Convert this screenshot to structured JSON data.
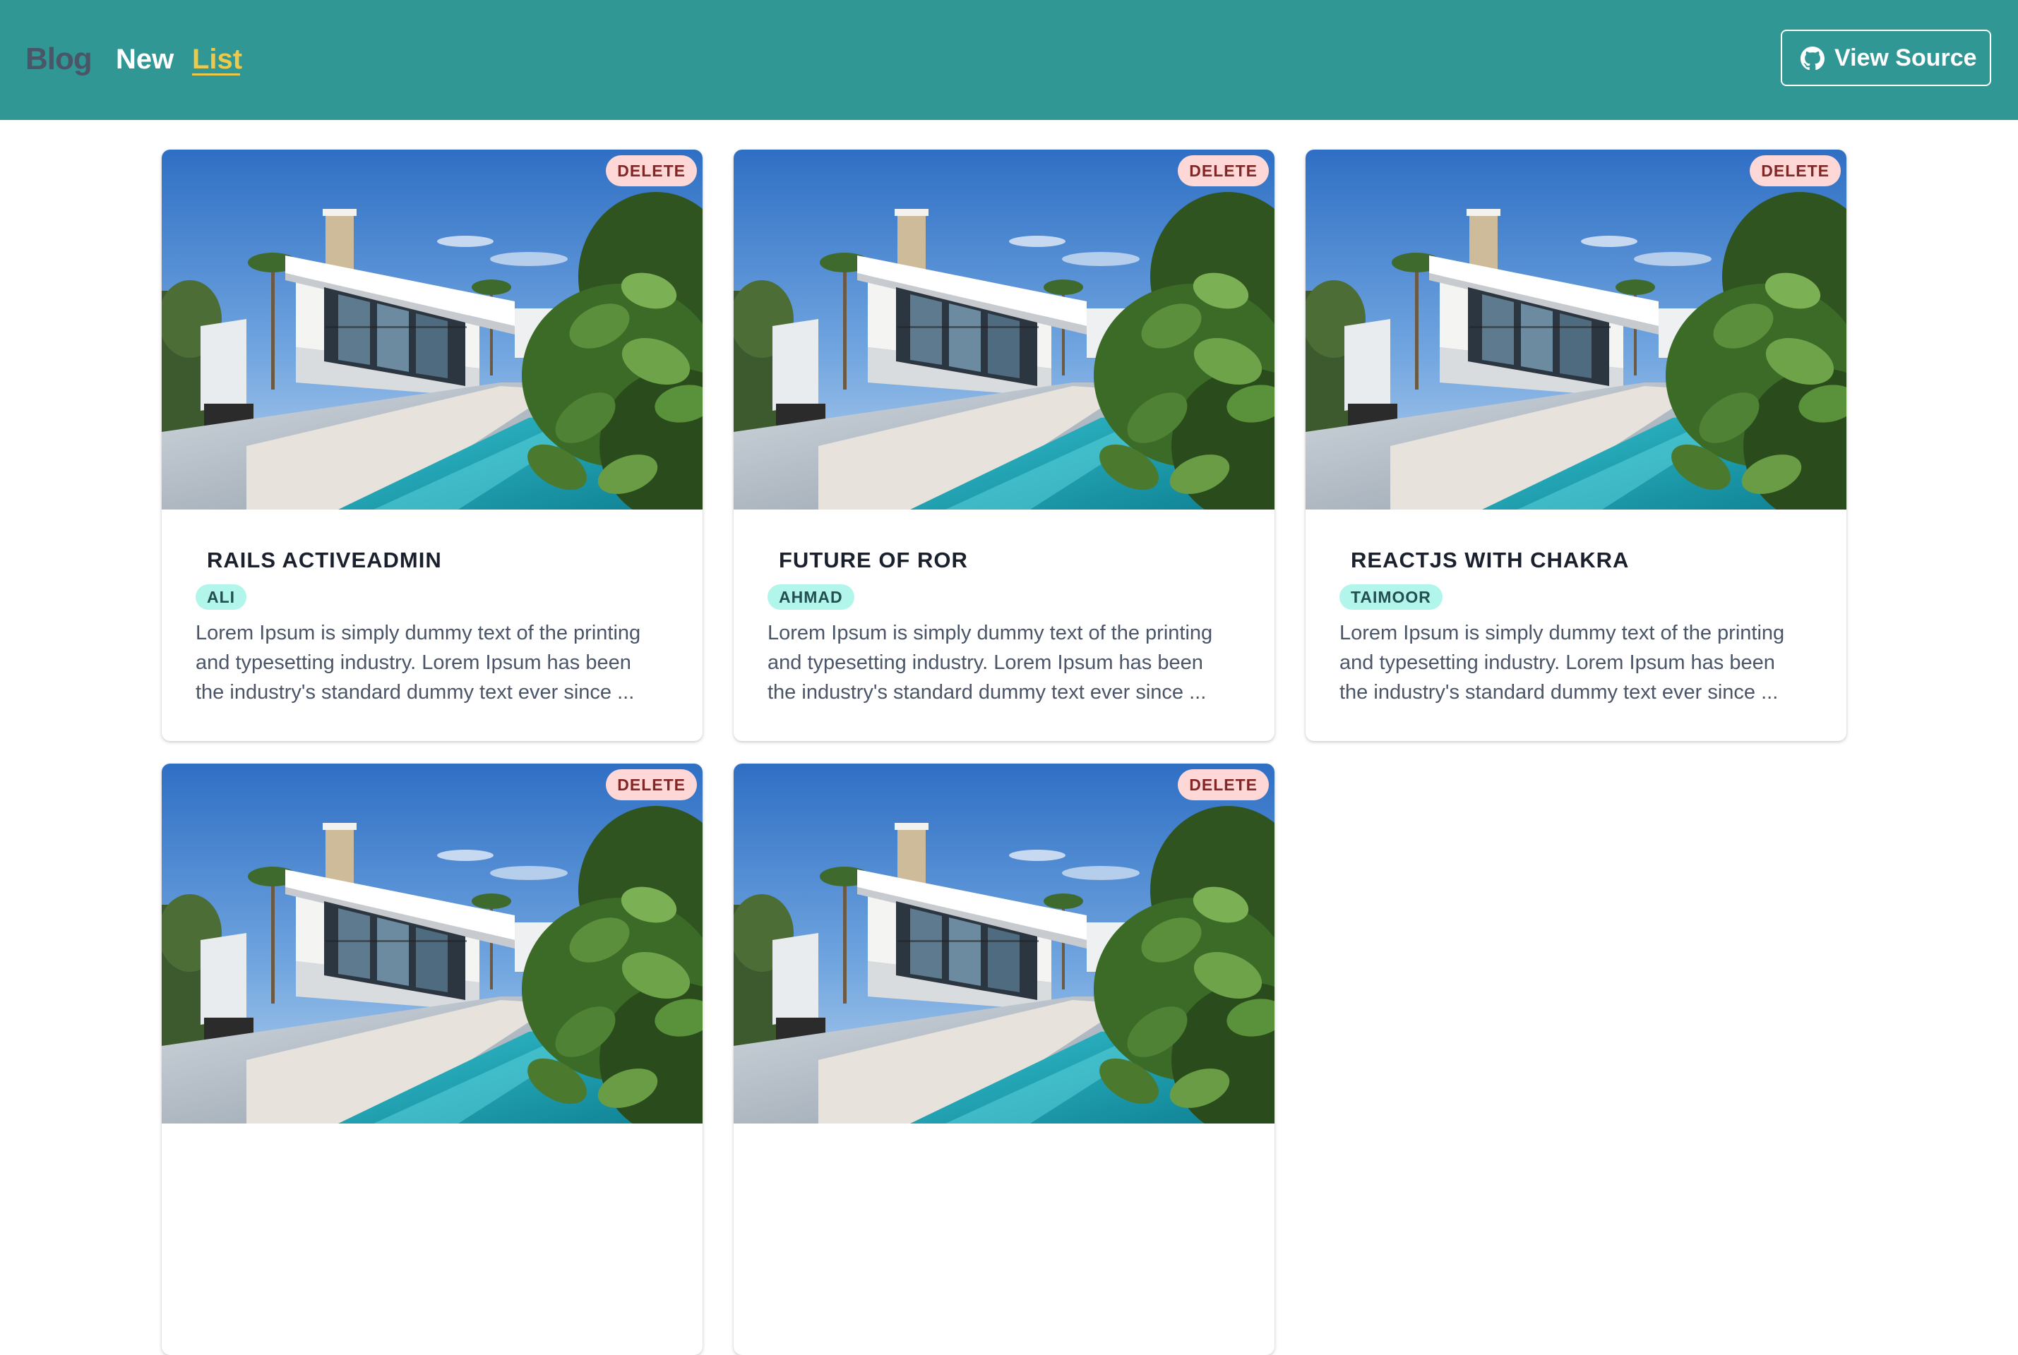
{
  "header": {
    "brand": "Blog",
    "nav": {
      "new_label": "New",
      "list_label": "List"
    },
    "view_source_label": "View Source",
    "colors": {
      "background": "#319795",
      "active_link": "#ecc94b",
      "brand": "#4a5568"
    }
  },
  "cards": [
    {
      "title": "RAILS ACTIVEADMIN",
      "author": "ALI",
      "delete_label": "DELETE",
      "excerpt_lines": [
        "Lorem Ipsum is simply dummy text of the printing",
        "and typesetting industry. Lorem Ipsum has been",
        "the industry's standard dummy text ever since ..."
      ]
    },
    {
      "title": "FUTURE OF ROR",
      "author": "AHMAD",
      "delete_label": "DELETE",
      "excerpt_lines": [
        "Lorem Ipsum is simply dummy text of the printing",
        "and typesetting industry. Lorem Ipsum has been",
        "the industry's standard dummy text ever since ..."
      ]
    },
    {
      "title": "REACTJS WITH CHAKRA",
      "author": "TAIMOOR",
      "delete_label": "DELETE",
      "excerpt_lines": [
        "Lorem Ipsum is simply dummy text of the printing",
        "and typesetting industry. Lorem Ipsum has been",
        "the industry's standard dummy text ever since ..."
      ]
    },
    {
      "delete_label": "DELETE"
    },
    {
      "delete_label": "DELETE"
    }
  ],
  "icons": {
    "view_source": "github-icon",
    "card_image": "house-pool-photo"
  },
  "colors": {
    "delete_badge_bg": "#fed7d7",
    "delete_badge_text": "#822727",
    "author_badge_bg": "#b2f5ea",
    "author_badge_text": "#234e52"
  }
}
